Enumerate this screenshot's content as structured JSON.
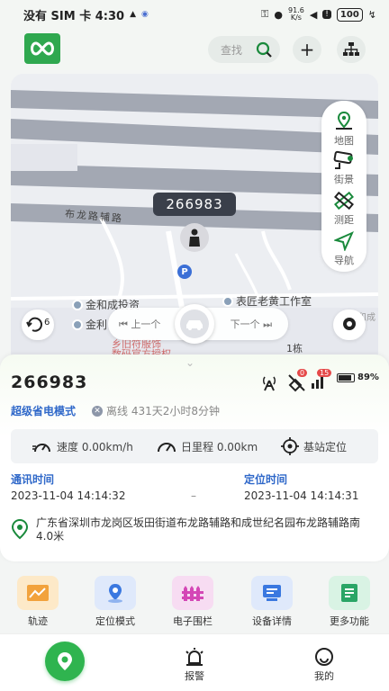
{
  "status_bar": {
    "carrier_time": "没有 SIM 卡 4:30",
    "network_speed_value": "91.6",
    "network_speed_unit": "K/s",
    "battery": "100"
  },
  "top_bar": {
    "search_label": "查找"
  },
  "map": {
    "tools": [
      {
        "label": "地图",
        "icon": "map-pin-icon"
      },
      {
        "label": "街景",
        "icon": "street-view-icon"
      },
      {
        "label": "测距",
        "icon": "ruler-icon"
      },
      {
        "label": "导航",
        "icon": "navigate-icon"
      }
    ],
    "device_tag": "266983",
    "road_label": "布龙路辅路",
    "parking_badge": "P",
    "poi_1": "金和成投资",
    "poi_2": "表匠老黄工作室",
    "poi_3": "金利",
    "poi_4": "乡旧符服饰",
    "poi_5": "数码官方授权",
    "poi_6": "1栋",
    "poi_7": "和成",
    "refresh_seconds": "6",
    "prev_label": "上一个",
    "next_label": "下一个"
  },
  "card": {
    "device_id": "266983",
    "signal_badge": "0",
    "cell_badge": "15",
    "battery_percent": "89%",
    "power_mode": "超级省电模式",
    "offline_text": "离线 431天2小时8分钟",
    "speed": "速度 0.00km/h",
    "daily_mileage": "日里程 0.00km",
    "positioning": "基站定位",
    "comm_time_label": "通讯时间",
    "comm_time_value": "2023-11-04 14:14:32",
    "separator": "–",
    "loc_time_label": "定位时间",
    "loc_time_value": "2023-11-04 14:14:31",
    "address": "广东省深圳市龙岗区坂田街道布龙路辅路和成世纪名园布龙路辅路南4.0米"
  },
  "functions": [
    {
      "label": "轨迹",
      "icon": "track-icon",
      "color": "#fde9c8"
    },
    {
      "label": "定位模式",
      "icon": "location-mode-icon",
      "color": "#dfe9fb"
    },
    {
      "label": "电子围栏",
      "icon": "fence-icon",
      "color": "#f7dcf2"
    },
    {
      "label": "设备详情",
      "icon": "device-detail-icon",
      "color": "#dfe9fb"
    },
    {
      "label": "更多功能",
      "icon": "more-icon",
      "color": "#d9f3e4"
    }
  ],
  "bottom_nav": {
    "alarm": "报警",
    "mine": "我的"
  },
  "colors": {
    "brand_green": "#2fb44f",
    "link_blue": "#2f68c9"
  }
}
